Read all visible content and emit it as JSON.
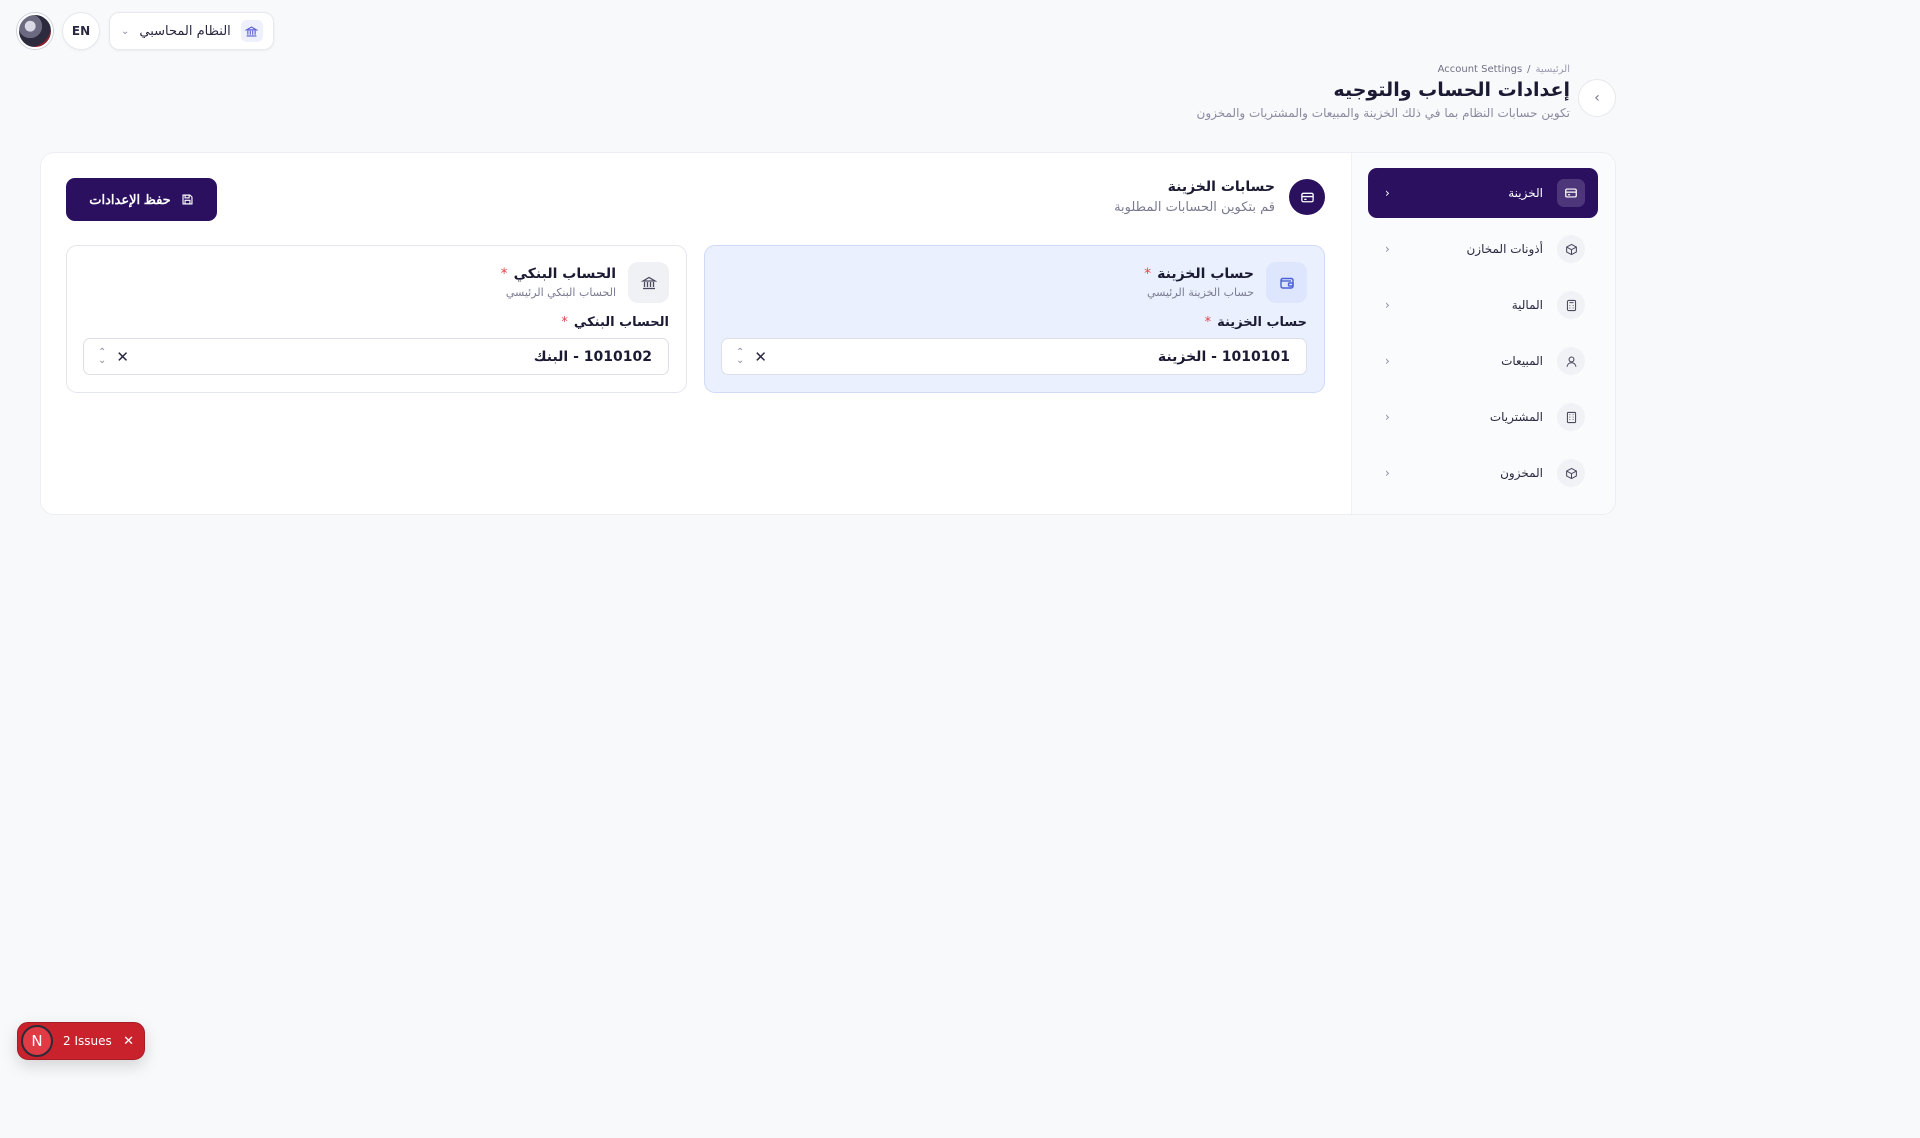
{
  "topbar": {
    "language": "EN",
    "system_label": "النظام المحاسبي",
    "system_icon": "bank-icon"
  },
  "header": {
    "breadcrumb_home": "الرئيسية",
    "breadcrumb_sep": "/",
    "breadcrumb_current": "Account Settings",
    "title": "إعدادات الحساب والتوجيه",
    "subtitle": "تكوين حسابات النظام بما في ذلك الخزينة والمبيعات والمشتريات والمخزون"
  },
  "sidebar": {
    "items": [
      {
        "label": "الخزينة",
        "icon": "card-icon",
        "active": true
      },
      {
        "label": "أذونات المخازن",
        "icon": "box-icon",
        "active": false
      },
      {
        "label": "المالية",
        "icon": "calculator-icon",
        "active": false
      },
      {
        "label": "المبيعات",
        "icon": "user-icon",
        "active": false
      },
      {
        "label": "المشتريات",
        "icon": "building-icon",
        "active": false
      },
      {
        "label": "المخزون",
        "icon": "box-icon",
        "active": false
      }
    ]
  },
  "section": {
    "title": "حسابات الخزينة",
    "subtitle": "قم بتكوين الحسابات المطلوبة",
    "save_label": "حفظ الإعدادات"
  },
  "accounts": [
    {
      "title": "حساب الخزينة",
      "subtitle": "حساب الخزينة الرئيسي",
      "field_label": "حساب الخزينة",
      "value": "1010101 - الخزينة",
      "required_mark": "*",
      "icon": "wallet-icon"
    },
    {
      "title": "الحساب البنكي",
      "subtitle": "الحساب البنكي الرئيسي",
      "field_label": "الحساب البنكي",
      "value": "1010102 - البنك",
      "required_mark": "*",
      "icon": "bank-icon"
    }
  ],
  "issues": {
    "badge": "N",
    "label": "2 Issues"
  },
  "colors": {
    "primary": "#2b1060",
    "active_box_bg": "#eaf0fd",
    "required": "#e0434b",
    "issues_bg": "#c9222d"
  }
}
